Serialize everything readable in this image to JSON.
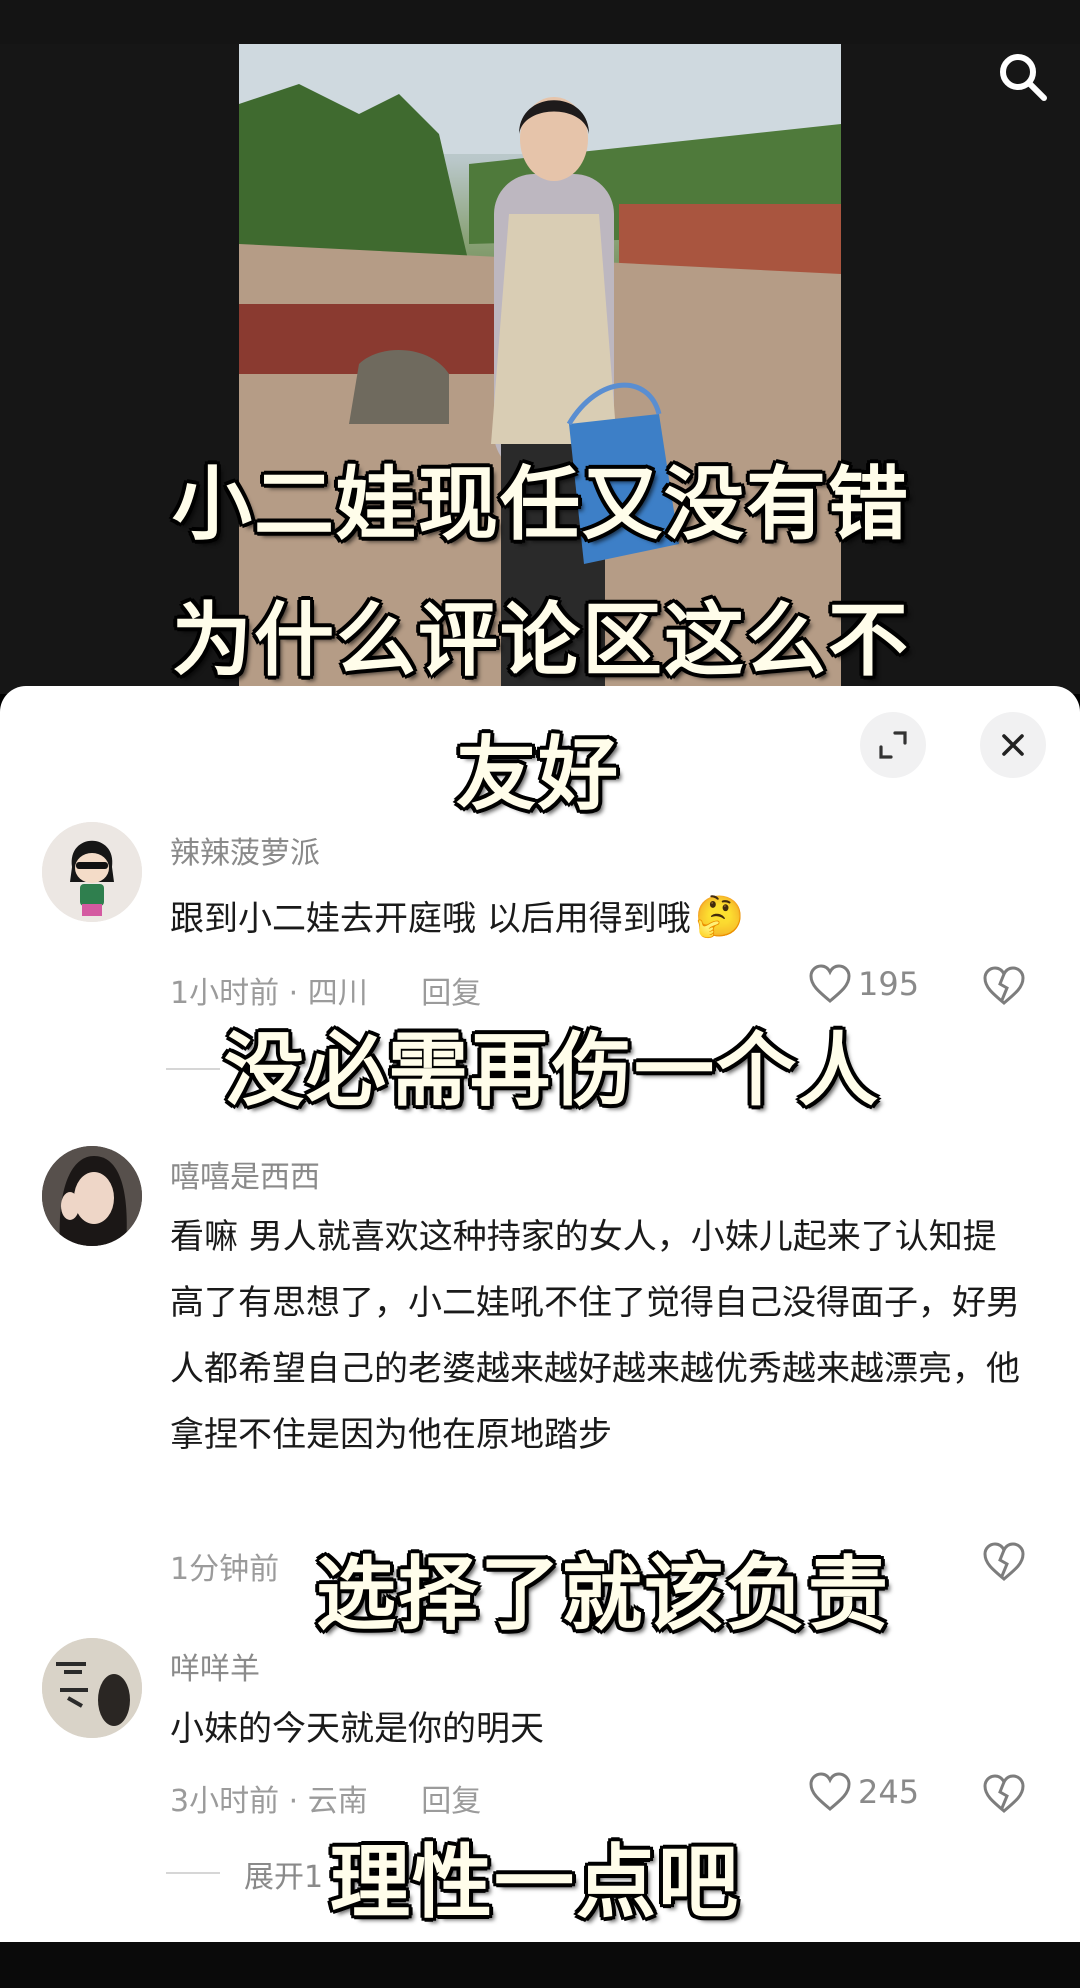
{
  "captions": {
    "line1": "小二娃现任又没有错",
    "line2": "为什么评论区这么不",
    "line3": "友好",
    "line4": "没必需再伤一个人",
    "line5": "选择了就该负责",
    "line6": "理性一点吧"
  },
  "comments": [
    {
      "username": "辣辣菠萝派",
      "text": "跟到小二娃去开庭哦  以后用得到哦",
      "emoji": "🤔",
      "time": "1小时前",
      "location": "四川",
      "reply": "回复",
      "likes": "195"
    },
    {
      "username": "嘻嘻是西西",
      "text": "看嘛 男人就喜欢这种持家的女人，小妹儿起来了认知提高了有思想了，小二娃吼不住了觉得自己没得面子，好男人都希望自己的老婆越来越好越来越优秀越来越漂亮，他拿捏不住是因为他在原地踏步",
      "time": "1分钟前"
    },
    {
      "username": "咩咩羊",
      "text": "小妹的今天就是你的明天",
      "time": "3小时前",
      "location": "云南",
      "reply": "回复",
      "likes": "245",
      "expand": "展开1"
    }
  ],
  "colors": {
    "caption": "#fffdea",
    "sheet": "#ffffff",
    "muted": "#8a8a8a"
  }
}
